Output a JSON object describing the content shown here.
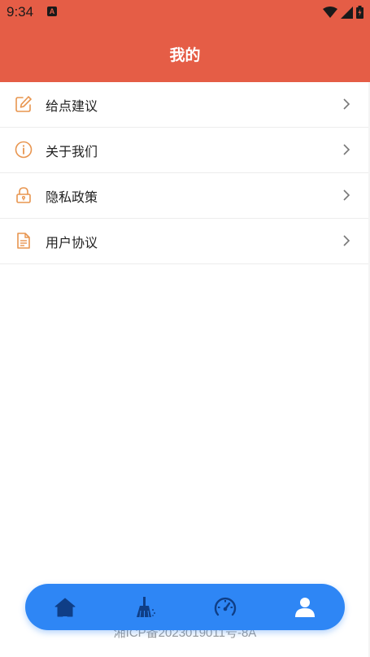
{
  "statusbar": {
    "time": "9:34",
    "app_badge": "A"
  },
  "header": {
    "title": "我的",
    "background": "#e55d46"
  },
  "menu": {
    "items": [
      {
        "label": "给点建议",
        "icon": "edit-icon"
      },
      {
        "label": "关于我们",
        "icon": "info-icon"
      },
      {
        "label": "隐私政策",
        "icon": "lock-icon"
      },
      {
        "label": "用户协议",
        "icon": "document-icon"
      }
    ],
    "icon_color": "#e8954f"
  },
  "footer": {
    "icp": "湘ICP备2023019011号-8A"
  },
  "bottom_nav": {
    "background": "#2e86f5",
    "items": [
      {
        "icon": "home-icon"
      },
      {
        "icon": "broom-clean-icon"
      },
      {
        "icon": "speedometer-icon"
      },
      {
        "icon": "user-profile-icon",
        "active": true
      }
    ]
  }
}
